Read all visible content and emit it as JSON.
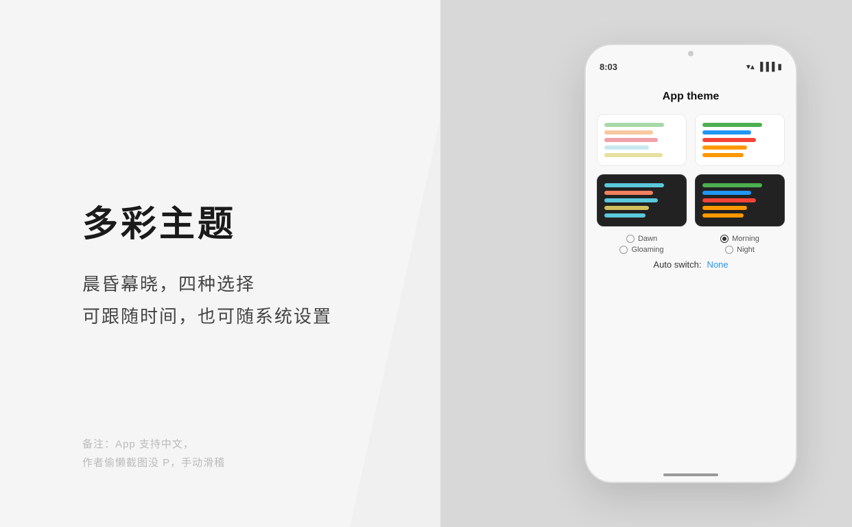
{
  "background": {
    "left_color": "#f5f5f5",
    "right_color": "#d8d8d8"
  },
  "left_panel": {
    "main_title": "多彩主题",
    "subtitle_line1": "晨昏幕晓，四种选择",
    "subtitle_line2": "可跟随时间，也可随系统设置",
    "note_line1": "备注：App 支持中文，",
    "note_line2": "作者偷懒截图没 P，手动滑稽"
  },
  "phone": {
    "time": "8:03",
    "screen_title": "App theme",
    "themes": [
      {
        "id": "dawn",
        "label": "Dawn",
        "type": "light",
        "selected": false
      },
      {
        "id": "morning",
        "label": "Morning",
        "type": "light",
        "selected": true
      },
      {
        "id": "gloaming",
        "label": "Gloaming",
        "type": "dark",
        "selected": false
      },
      {
        "id": "night",
        "label": "Night",
        "type": "dark",
        "selected": false
      }
    ],
    "auto_switch_label": "Auto switch:",
    "auto_switch_value": "None"
  }
}
